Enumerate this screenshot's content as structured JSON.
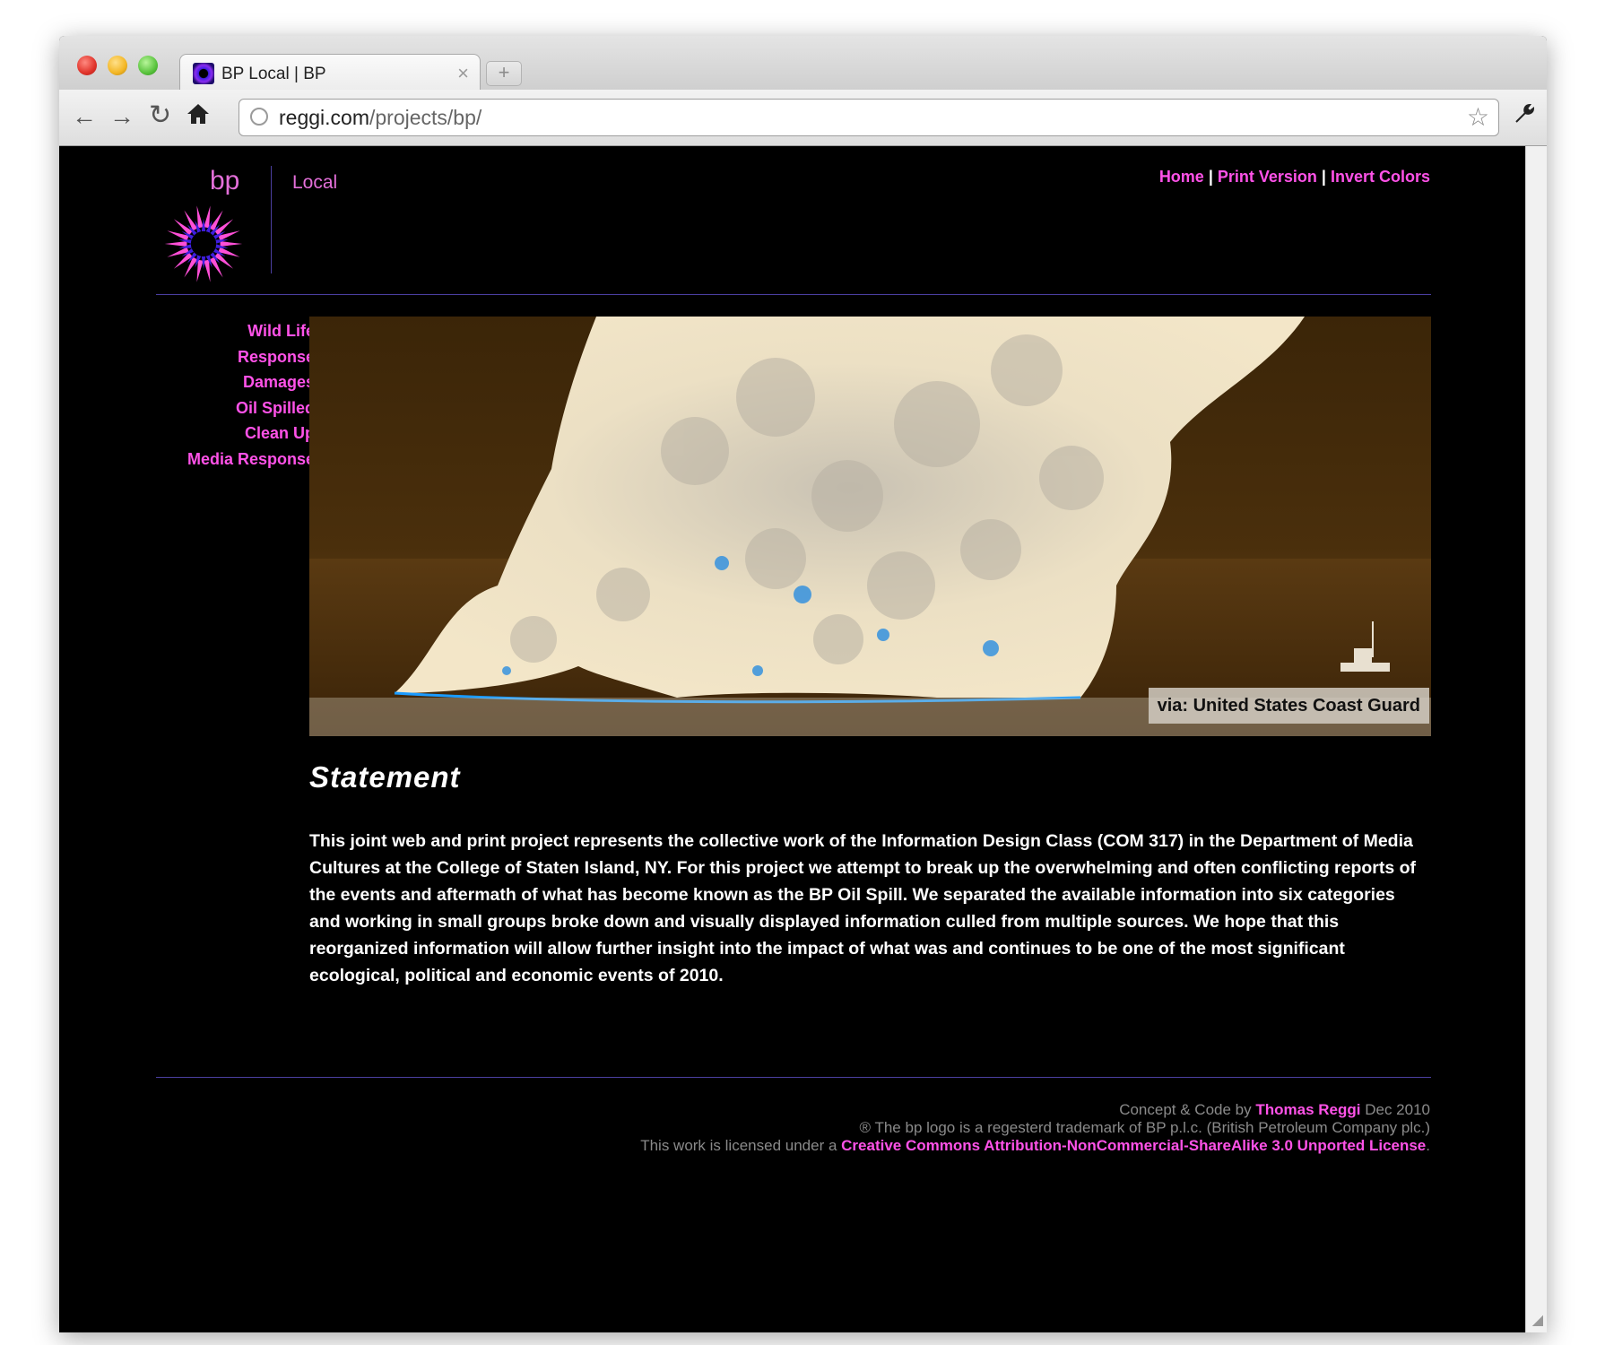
{
  "browser": {
    "tab_title": "BP Local | BP",
    "url_host": "reggi.com",
    "url_path": "/projects/bp/",
    "tab_close_symbol": "×",
    "new_tab_symbol": "+"
  },
  "site": {
    "logo_word": "bp",
    "section_label": "Local",
    "logo_colors": [
      "#ff4fd8",
      "#3f1ee0",
      "#000000"
    ]
  },
  "topnav": {
    "home": "Home",
    "print": "Print Version",
    "invert": "Invert Colors",
    "separator": "|"
  },
  "sidenav": {
    "items": [
      "Wild Life",
      "Response",
      "Damages",
      "Oil Spilled",
      "Clean Up",
      "Media Response"
    ]
  },
  "hero": {
    "caption": "via: United States Coast Guard"
  },
  "statement": {
    "title": "Statement",
    "body": "This joint web and print project represents the collective work of the Information Design Class (COM 317) in the Department of Media Cultures at the College of Staten Island, NY. For this project we attempt to break up the overwhelming and often conflicting reports of the events and aftermath of what has become known as the BP Oil Spill. We separated the available information into six categories and working in small groups broke down and visually displayed information culled from multiple sources. We hope that this reorganized information will allow further insight into the impact of what was and continues to be one of the most significant ecological, political and economic events of 2010."
  },
  "footer": {
    "credit_prefix": "Concept & Code by",
    "author": "Thomas Reggi",
    "credit_suffix": "Dec 2010",
    "trademark": "® The bp logo is a regesterd trademark of BP p.l.c. (British Petroleum Company plc.)",
    "license_prefix": "This work is licensed under a",
    "license_link": "Creative Commons Attribution-NonCommercial-ShareAlike 3.0 Unported License",
    "license_suffix": "."
  },
  "colors": {
    "accent": "#ff52e8",
    "rule": "#4b3fa0",
    "background": "#000000"
  }
}
